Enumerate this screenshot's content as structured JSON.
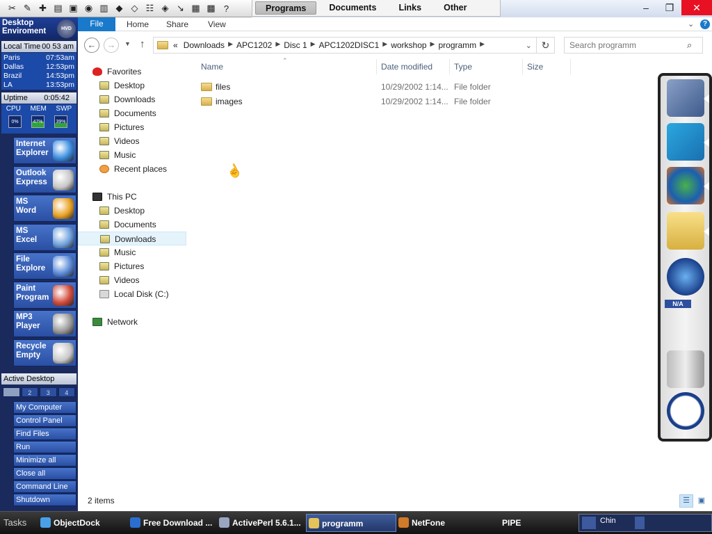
{
  "topbar": {
    "tool_icons": [
      "ticket-icon",
      "note-icon",
      "plus-icon",
      "archive-icon",
      "screenshot-icon",
      "camera-icon",
      "book-icon",
      "app-icon",
      "card-icon",
      "network-icon",
      "shield-icon",
      "exit-icon",
      "panel-icon",
      "tv-icon",
      "help-icon"
    ],
    "menu_tabs": [
      "Programs",
      "Documents",
      "Links",
      "Other"
    ],
    "selected_tab": "Programs"
  },
  "left_panel": {
    "title_line1": "Desktop",
    "title_line2": "Enviroment",
    "badge": "HVD",
    "local_time_label": "Local Time",
    "local_time_value": "00 53 am",
    "cities": [
      {
        "name": "Paris",
        "time": "07:53am"
      },
      {
        "name": "Dallas",
        "time": "12:53pm"
      },
      {
        "name": "Brazil",
        "time": "14:53pm"
      },
      {
        "name": "LA",
        "time": "13:53pm"
      }
    ],
    "uptime_label": "Uptime",
    "uptime_value": "0:05:42",
    "meters": [
      {
        "label": "CPU",
        "value": "0%",
        "level": 0
      },
      {
        "label": "MEM",
        "value": "47%",
        "level": 0.47
      },
      {
        "label": "SWP",
        "value": "39%",
        "level": 0.39
      }
    ],
    "apps": [
      {
        "l1": "Internet",
        "l2": "Explorer",
        "icon": "globe-icon",
        "color": "#3a8de0"
      },
      {
        "l1": "Outlook",
        "l2": "Express",
        "icon": "envelope-icon",
        "color": "#c7c7c7"
      },
      {
        "l1": "MS",
        "l2": "Word",
        "icon": "windows-flag-icon",
        "color": "#e8a020"
      },
      {
        "l1": "MS",
        "l2": "Excel",
        "icon": "spreadsheet-icon",
        "color": "#6ea0dd"
      },
      {
        "l1": "File",
        "l2": "Explore",
        "icon": "folder-window-icon",
        "color": "#5a8ad8"
      },
      {
        "l1": "Paint",
        "l2": "Program",
        "icon": "paint-icon",
        "color": "#d24a3a"
      },
      {
        "l1": "MP3",
        "l2": "Player",
        "icon": "speaker-icon",
        "color": "#9a9a9a"
      },
      {
        "l1": "Recycle",
        "l2": "Empty",
        "icon": "recycle-bin-icon",
        "color": "#c8c8c8"
      }
    ],
    "active_desktop_label": "Active Desktop",
    "desktops": [
      "",
      "2",
      "3",
      "4"
    ],
    "links": [
      "My Computer",
      "Control Panel",
      "Find Files",
      "Run",
      "Minimize all",
      "Close all",
      "Command Line",
      "Shutdown"
    ]
  },
  "ribbon": {
    "file_tab": "File",
    "tabs": [
      "Home",
      "Share",
      "View"
    ]
  },
  "address": {
    "prefix": "«",
    "crumbs": [
      "Downloads",
      "APC1202",
      "Disc 1",
      "APC1202DISC1",
      "workshop",
      "programm"
    ]
  },
  "search": {
    "placeholder": "Search programm"
  },
  "nav_pane": {
    "favorites_label": "Favorites",
    "favorites": [
      "Desktop",
      "Downloads",
      "Documents",
      "Pictures",
      "Videos",
      "Music",
      "Recent places"
    ],
    "thispc_label": "This PC",
    "thispc": [
      "Desktop",
      "Documents",
      "Downloads",
      "Music",
      "Pictures",
      "Videos",
      "Local Disk (C:)"
    ],
    "network_label": "Network"
  },
  "columns": [
    "Name",
    "Date modified",
    "Type",
    "Size"
  ],
  "files": [
    {
      "name": "files",
      "date": "10/29/2002 1:14...",
      "type": "File folder"
    },
    {
      "name": "images",
      "date": "10/29/2002 1:14...",
      "type": "File folder"
    }
  ],
  "status_text": "2 items",
  "dock": {
    "items": [
      "blueprint-icon",
      "share-arrow-icon",
      "globe-refresh-icon",
      "folder-icon",
      "windows-orb-icon",
      "recycle-bin-icon",
      "clock-icon"
    ],
    "na_label": "N/A"
  },
  "taskbar": {
    "tasks_label": "Tasks",
    "items": [
      {
        "label": "ObjectDock",
        "icon": "dock-icon",
        "color": "#4aa0e8"
      },
      {
        "label": "Free Download ...",
        "icon": "download-icon",
        "color": "#2a6fd0"
      },
      {
        "label": "ActivePerl 5.6.1...",
        "icon": "installer-icon",
        "color": "#9aa6c0"
      },
      {
        "label": "programm",
        "icon": "folder-icon",
        "color": "#e5c35a"
      },
      {
        "label": "NetFone",
        "icon": "phone-icon",
        "color": "#d07a2a"
      },
      {
        "label": "PIPE",
        "icon": "",
        "color": ""
      }
    ],
    "tray_text": "Chin"
  }
}
